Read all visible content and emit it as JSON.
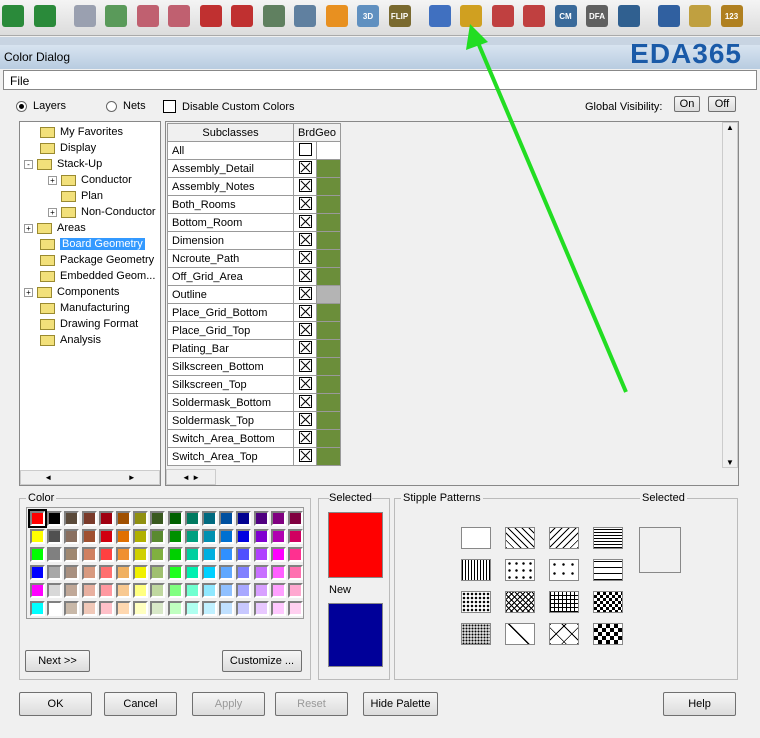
{
  "toolbar": {
    "icons": [
      "globe-icon",
      "pin-icon",
      "grid-icon",
      "grid2-icon",
      "zoom-fit-icon",
      "zoom-box-icon",
      "zoom-in-icon",
      "zoom-out-icon",
      "zoom-prev-icon",
      "zoom-world-icon",
      "refresh-icon",
      "3d-icon",
      "flip-icon",
      "grid-dots-icon",
      "color-dialog-icon",
      "palette-icon",
      "layers-icon",
      "cm-icon",
      "dfa-icon",
      "world-icon",
      "route-icon",
      "board-icon",
      "measure-icon"
    ],
    "labels": {
      "3d": "3D",
      "flip": "FLIP",
      "cm": "CM",
      "dfa": "DFA",
      "measure": "123"
    }
  },
  "window": {
    "title": "Color Dialog",
    "watermark": "EDA365"
  },
  "menu": {
    "file": "File"
  },
  "options": {
    "layers": "Layers",
    "nets": "Nets",
    "disable_custom": "Disable Custom Colors",
    "global_visibility": "Global Visibility:",
    "on": "On",
    "off": "Off"
  },
  "tree": [
    {
      "label": "My Favorites",
      "level": 1
    },
    {
      "label": "Display",
      "level": 1
    },
    {
      "label": "Stack-Up",
      "level": 0,
      "exp": "-"
    },
    {
      "label": "Conductor",
      "level": 2,
      "exp": "+"
    },
    {
      "label": "Plan",
      "level": 2
    },
    {
      "label": "Non-Conductor",
      "level": 2,
      "exp": "+"
    },
    {
      "label": "Areas",
      "level": 0,
      "exp": "+"
    },
    {
      "label": "Board Geometry",
      "level": 1,
      "selected": true
    },
    {
      "label": "Package Geometry",
      "level": 1
    },
    {
      "label": "Embedded Geom...",
      "level": 1
    },
    {
      "label": "Components",
      "level": 0,
      "exp": "+"
    },
    {
      "label": "Manufacturing",
      "level": 1
    },
    {
      "label": "Drawing Format",
      "level": 1
    },
    {
      "label": "Analysis",
      "level": 1
    }
  ],
  "grid": {
    "col_subclasses": "Subclasses",
    "col_brdgeo": "BrdGeo",
    "rows": [
      {
        "name": "All",
        "color": ""
      },
      {
        "name": "Assembly_Detail",
        "color": "#6b8e3a"
      },
      {
        "name": "Assembly_Notes",
        "color": "#6b8e3a"
      },
      {
        "name": "Both_Rooms",
        "color": "#6b8e3a"
      },
      {
        "name": "Bottom_Room",
        "color": "#6b8e3a"
      },
      {
        "name": "Dimension",
        "color": "#6b8e3a"
      },
      {
        "name": "Ncroute_Path",
        "color": "#6b8e3a"
      },
      {
        "name": "Off_Grid_Area",
        "color": "#6b8e3a"
      },
      {
        "name": "Outline",
        "color": "#b4b4b4"
      },
      {
        "name": "Place_Grid_Bottom",
        "color": "#6b8e3a"
      },
      {
        "name": "Place_Grid_Top",
        "color": "#6b8e3a"
      },
      {
        "name": "Plating_Bar",
        "color": "#6b8e3a"
      },
      {
        "name": "Silkscreen_Bottom",
        "color": "#6b8e3a"
      },
      {
        "name": "Silkscreen_Top",
        "color": "#6b8e3a"
      },
      {
        "name": "Soldermask_Bottom",
        "color": "#6b8e3a"
      },
      {
        "name": "Soldermask_Top",
        "color": "#6b8e3a"
      },
      {
        "name": "Switch_Area_Bottom",
        "color": "#6b8e3a"
      },
      {
        "name": "Switch_Area_Top",
        "color": "#6b8e3a"
      }
    ]
  },
  "color": {
    "label": "Color",
    "next": "Next >>",
    "customize": "Customize ...",
    "palette": [
      [
        "#ff0000",
        "#000000",
        "#5a4a3a",
        "#7a3a2a",
        "#a00010",
        "#a05000",
        "#909010",
        "#3a5a20",
        "#006000",
        "#007a60",
        "#006a80",
        "#0050a0",
        "#000090",
        "#500080",
        "#800080",
        "#800040"
      ],
      [
        "#ffff00",
        "#505050",
        "#8a7060",
        "#a05030",
        "#d00010",
        "#e07000",
        "#b0b000",
        "#5a8a30",
        "#009000",
        "#00a080",
        "#0090b0",
        "#0070d0",
        "#0000e0",
        "#8000d0",
        "#b000b0",
        "#d00060"
      ],
      [
        "#00ff00",
        "#808080",
        "#a08870",
        "#d08060",
        "#ff4040",
        "#f09030",
        "#d0d000",
        "#80b040",
        "#00d000",
        "#00d0a0",
        "#00b0e0",
        "#3090ff",
        "#5050ff",
        "#b040ff",
        "#ff00ff",
        "#ff3090"
      ],
      [
        "#0000ff",
        "#a8a8a8",
        "#a89080",
        "#d89a80",
        "#ff7070",
        "#f0b060",
        "#f0f000",
        "#a0c070",
        "#20ff20",
        "#00f0b0",
        "#00d0ff",
        "#60a8ff",
        "#8080ff",
        "#c870ff",
        "#ff60ff",
        "#ff70b0"
      ],
      [
        "#ff00ff",
        "#d8d8d8",
        "#c0a898",
        "#e8b0a0",
        "#ff98a0",
        "#f8c890",
        "#ffff80",
        "#c0d8a0",
        "#80ff80",
        "#70ffd0",
        "#90e8ff",
        "#90c0ff",
        "#a8a8ff",
        "#d8a0ff",
        "#ffa0ff",
        "#ffa8d0"
      ],
      [
        "#00ffff",
        "#ffffff",
        "#c8b8a8",
        "#f0c8b8",
        "#ffc0c8",
        "#ffd8b0",
        "#ffffc0",
        "#d8e8c8",
        "#c0ffc0",
        "#b0fff0",
        "#c0f0ff",
        "#c0e0ff",
        "#c8c8ff",
        "#e8c8ff",
        "#ffc8ff",
        "#ffd0f0"
      ]
    ]
  },
  "selected": {
    "label": "Selected",
    "new_label": "New",
    "selected_color": "#ff0000",
    "new_color": "#000099"
  },
  "stipple": {
    "label": "Stipple Patterns",
    "selected_label": "Selected",
    "patterns": [
      "solid",
      "diag-right",
      "diag-left",
      "horizontal",
      "vertical",
      "dots-sparse",
      "plus",
      "dashes",
      "dots-dense",
      "crosshatch-diag",
      "grid",
      "checker",
      "fine-dots",
      "diamond-outline",
      "x-outline",
      "diamond-fill"
    ]
  },
  "buttons": {
    "ok": "OK",
    "cancel": "Cancel",
    "apply": "Apply",
    "reset": "Reset",
    "hide_palette": "Hide Palette",
    "help": "Help"
  },
  "accent": {
    "arrow": "#22dd22"
  }
}
